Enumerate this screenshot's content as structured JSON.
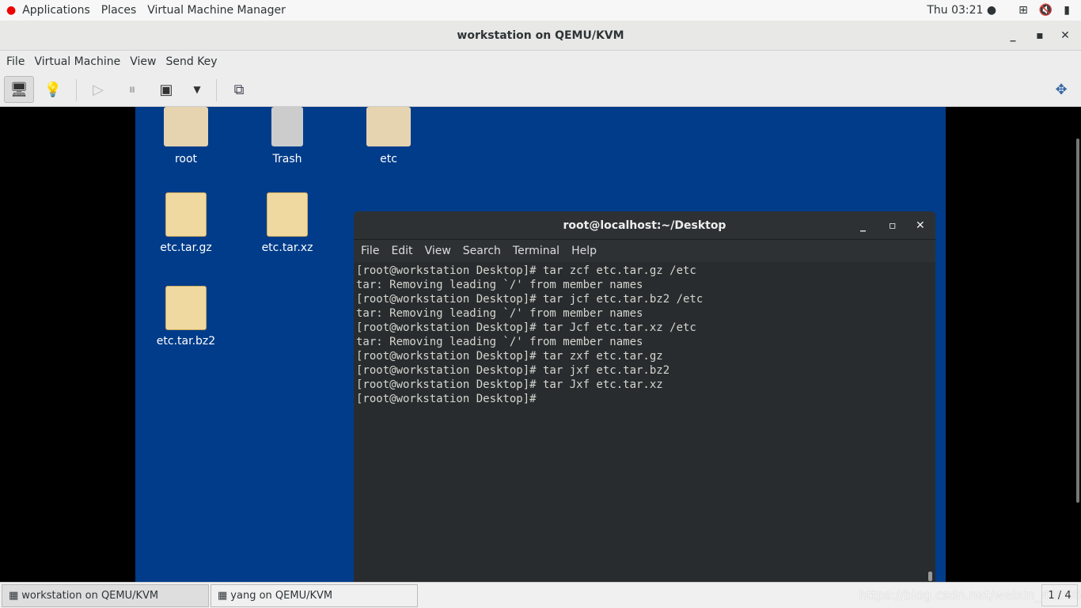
{
  "topbar": {
    "applications": "Applications",
    "places": "Places",
    "vmm": "Virtual Machine Manager",
    "clock": "Thu 03:21 ●"
  },
  "window": {
    "title": "workstation on QEMU/KVM",
    "menu": [
      "File",
      "Virtual Machine",
      "View",
      "Send Key"
    ]
  },
  "toolbar": {
    "icons": [
      "console-icon",
      "details-bulb-icon",
      "run-icon",
      "pause-icon",
      "shutdown-icon",
      "dropdown-icon",
      "snapshots-icon",
      "fullscreen-icon"
    ]
  },
  "desktop": {
    "icons": [
      "root",
      "Trash",
      "etc",
      "etc.tar.gz",
      "etc.tar.xz",
      "etc.tar.bz2"
    ]
  },
  "terminal": {
    "title": "root@localhost:~/Desktop",
    "menu": [
      "File",
      "Edit",
      "View",
      "Search",
      "Terminal",
      "Help"
    ],
    "lines": [
      "[root@workstation Desktop]# tar zcf etc.tar.gz /etc",
      "tar: Removing leading `/' from member names",
      "[root@workstation Desktop]# tar jcf etc.tar.bz2 /etc",
      "tar: Removing leading `/' from member names",
      "[root@workstation Desktop]# tar Jcf etc.tar.xz /etc",
      "tar: Removing leading `/' from member names",
      "[root@workstation Desktop]# tar zxf etc.tar.gz",
      "[root@workstation Desktop]# tar jxf etc.tar.bz2",
      "[root@workstation Desktop]# tar Jxf etc.tar.xz",
      "[root@workstation Desktop]#"
    ]
  },
  "taskbar": {
    "tasks": [
      "workstation on QEMU/KVM",
      "yang on QEMU/KVM"
    ],
    "workspace": "1 / 4",
    "watermark": "https://blog.csdn.net/weixin_42006832"
  }
}
